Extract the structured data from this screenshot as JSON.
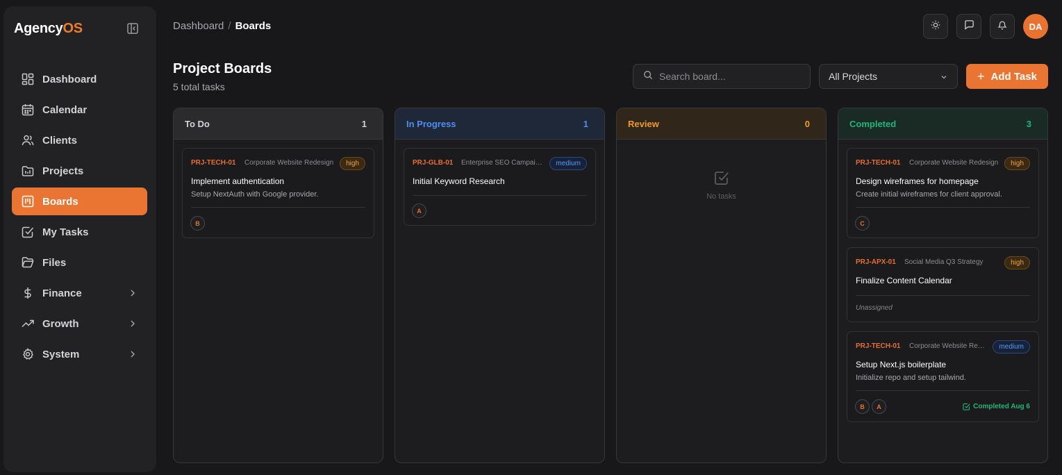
{
  "app": {
    "logo_main": "Agency",
    "logo_accent": "OS"
  },
  "sidebar": {
    "items": [
      {
        "label": "Dashboard",
        "icon": "layout-grid-icon"
      },
      {
        "label": "Calendar",
        "icon": "calendar-icon"
      },
      {
        "label": "Clients",
        "icon": "users-icon"
      },
      {
        "label": "Projects",
        "icon": "projects-icon"
      },
      {
        "label": "Boards",
        "icon": "kanban-icon",
        "active": true
      },
      {
        "label": "My Tasks",
        "icon": "check-square-icon"
      },
      {
        "label": "Files",
        "icon": "folder-icon"
      },
      {
        "label": "Finance",
        "icon": "dollar-icon",
        "expandable": true
      },
      {
        "label": "Growth",
        "icon": "trending-up-icon",
        "expandable": true
      },
      {
        "label": "System",
        "icon": "gear-icon",
        "expandable": true
      }
    ]
  },
  "header": {
    "breadcrumb": {
      "parent": "Dashboard",
      "separator": "/",
      "current": "Boards"
    },
    "avatar_initials": "DA"
  },
  "page": {
    "title": "Project Boards",
    "subtitle": "5 total tasks"
  },
  "toolbar": {
    "search_placeholder": "Search board...",
    "project_filter": "All Projects",
    "add_task_label": "Add Task"
  },
  "colors": {
    "accent": "#ea7431",
    "todo": "#d4d4d8",
    "in_progress": "#4c8ff3",
    "review": "#f09a2a",
    "completed": "#22b57a"
  },
  "columns": [
    {
      "name": "To Do",
      "count": "1",
      "cards": [
        {
          "code": "PRJ-TECH-01",
          "project": "Corporate Website Redesign",
          "priority": "high",
          "title": "Implement authentication",
          "description": "Setup NextAuth with Google provider.",
          "assignees": [
            "B"
          ]
        }
      ]
    },
    {
      "name": "In Progress",
      "count": "1",
      "cards": [
        {
          "code": "PRJ-GLB-01",
          "project": "Enterprise SEO Campaign",
          "priority": "medium",
          "title": "Initial Keyword Research",
          "assignees": [
            "A"
          ]
        }
      ]
    },
    {
      "name": "Review",
      "count": "0",
      "empty_label": "No tasks"
    },
    {
      "name": "Completed",
      "count": "3",
      "cards": [
        {
          "code": "PRJ-TECH-01",
          "project": "Corporate Website Redesign",
          "priority": "high",
          "title": "Design wireframes for homepage",
          "description": "Create initial wireframes for client approval.",
          "assignees": [
            "C"
          ]
        },
        {
          "code": "PRJ-APX-01",
          "project": "Social Media Q3 Strategy",
          "priority": "high",
          "title": "Finalize Content Calendar",
          "unassigned_label": "Unassigned"
        },
        {
          "code": "PRJ-TECH-01",
          "project": "Corporate Website Redesign",
          "priority": "medium",
          "title": "Setup Next.js boilerplate",
          "description": "Initialize repo and setup tailwind.",
          "assignees": [
            "B",
            "A"
          ],
          "completed_label": "Completed Aug 6"
        }
      ]
    }
  ]
}
